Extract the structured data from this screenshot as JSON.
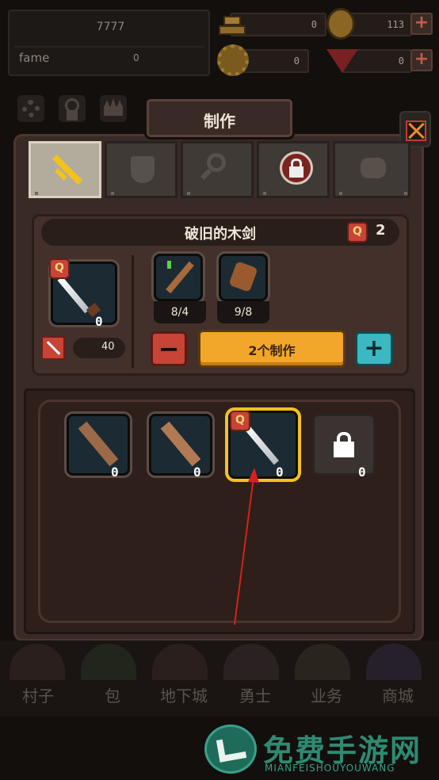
{
  "stats": {
    "gold_value": "7777",
    "fame_label": "fame",
    "fame_value": "0"
  },
  "resources": {
    "bars_value": "0",
    "coin_value": "113",
    "gear_value": "0",
    "gem_value": "0",
    "plus_symbol": "+"
  },
  "craft_title": "制作",
  "item": {
    "name": "破旧的木剑",
    "quality_count": "2",
    "quality_letter": "Q",
    "result_count": "0",
    "attack_value": "40"
  },
  "materials": [
    {
      "count": "8/4"
    },
    {
      "count": "9/8"
    }
  ],
  "craft_button": "2个制作",
  "minus_symbol": "−",
  "plus_symbol": "+",
  "recipes": [
    {
      "count": "0"
    },
    {
      "count": "0"
    },
    {
      "count": "0"
    },
    {
      "count": "0"
    }
  ],
  "bottom_nav": [
    "村子",
    "包",
    "地下城",
    "勇士",
    "业务",
    "商城"
  ],
  "watermark": {
    "title": "免费手游网",
    "subtitle": "MIANFEISHOUYOUWANG"
  },
  "colors": {
    "accent": "#f2a72a",
    "danger": "#c74436",
    "teal": "#3cb8c2"
  }
}
